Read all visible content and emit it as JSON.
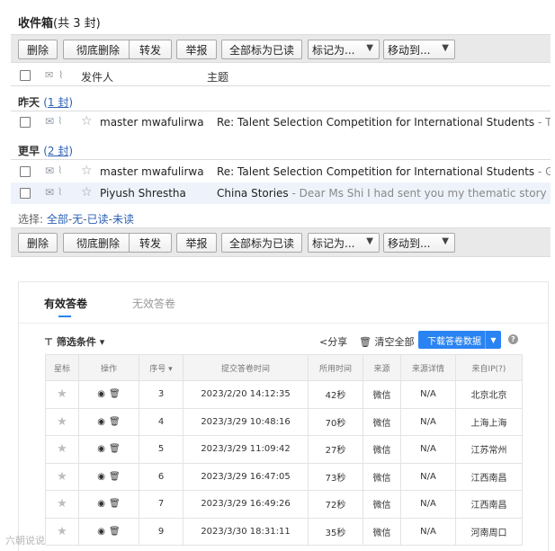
{
  "mailbox": {
    "title": "收件箱",
    "count": "(共 3 封)",
    "toolbar": {
      "delete": "删除",
      "delete_permanently": "彻底删除",
      "forward": "转发",
      "report": "举报",
      "mark_all_read": "全部标为已读",
      "mark_as": "标记为...",
      "move_to": "移动到..."
    },
    "columns": {
      "sender": "发件人",
      "subject": "主题"
    },
    "groups": [
      {
        "label": "昨天",
        "count": "1 封",
        "rows": [
          {
            "sender": "master mwafulirwa",
            "subject": "Re: Talent Selection Competition for International Students",
            "preview": " - Thank you"
          }
        ]
      },
      {
        "label": "更早",
        "count": "2 封",
        "rows": [
          {
            "sender": "master mwafulirwa",
            "subject": "Re: Talent Selection Competition for International Students",
            "preview": " - Good"
          },
          {
            "sender": "Piyush Shrestha",
            "subject": "China Stories",
            "preview": " - Dear Ms Shi I had sent you my thematic story with analy"
          }
        ]
      }
    ],
    "select": {
      "label": "选择:",
      "all": "全部",
      "none": "无",
      "read": "已读",
      "unread": "未读",
      "sep": "-"
    }
  },
  "survey": {
    "tabs": {
      "valid": "有效答卷",
      "invalid": "无效答卷"
    },
    "filter": "筛选条件",
    "share": "分享",
    "clear_all": "清空全部",
    "download": "下载答卷数据",
    "help": "?",
    "columns": [
      "星标",
      "操作",
      "序号",
      "提交答卷时间",
      "所用时间",
      "来源",
      "来源详情",
      "来自IP(?)"
    ],
    "rows": [
      {
        "seq": "3",
        "time": "2023/2/20 14:12:35",
        "duration": "42秒",
        "source": "微信",
        "detail": "N/A",
        "ip": "北京北京"
      },
      {
        "seq": "4",
        "time": "2023/3/29 10:48:16",
        "duration": "70秒",
        "source": "微信",
        "detail": "N/A",
        "ip": "上海上海"
      },
      {
        "seq": "5",
        "time": "2023/3/29 11:09:42",
        "duration": "27秒",
        "source": "微信",
        "detail": "N/A",
        "ip": "江苏常州"
      },
      {
        "seq": "6",
        "time": "2023/3/29 16:47:05",
        "duration": "73秒",
        "source": "微信",
        "detail": "N/A",
        "ip": "江西南昌"
      },
      {
        "seq": "7",
        "time": "2023/3/29 16:49:26",
        "duration": "72秒",
        "source": "微信",
        "detail": "N/A",
        "ip": "江西南昌"
      },
      {
        "seq": "9",
        "time": "2023/3/30 18:31:11",
        "duration": "35秒",
        "source": "微信",
        "detail": "N/A",
        "ip": "河南周口"
      }
    ]
  },
  "watermark": "六朝说说",
  "icons": [
    "checkbox-icon",
    "envelope-icon",
    "paperclip-icon",
    "star-icon",
    "chevron-down-icon",
    "filter-icon",
    "share-icon",
    "trash-icon",
    "eye-icon",
    "sort-icon",
    "help-icon"
  ],
  "colors": {
    "accent": "#2a83f2",
    "link": "#2b5fb4",
    "toolbar": "#e9e9e9"
  }
}
